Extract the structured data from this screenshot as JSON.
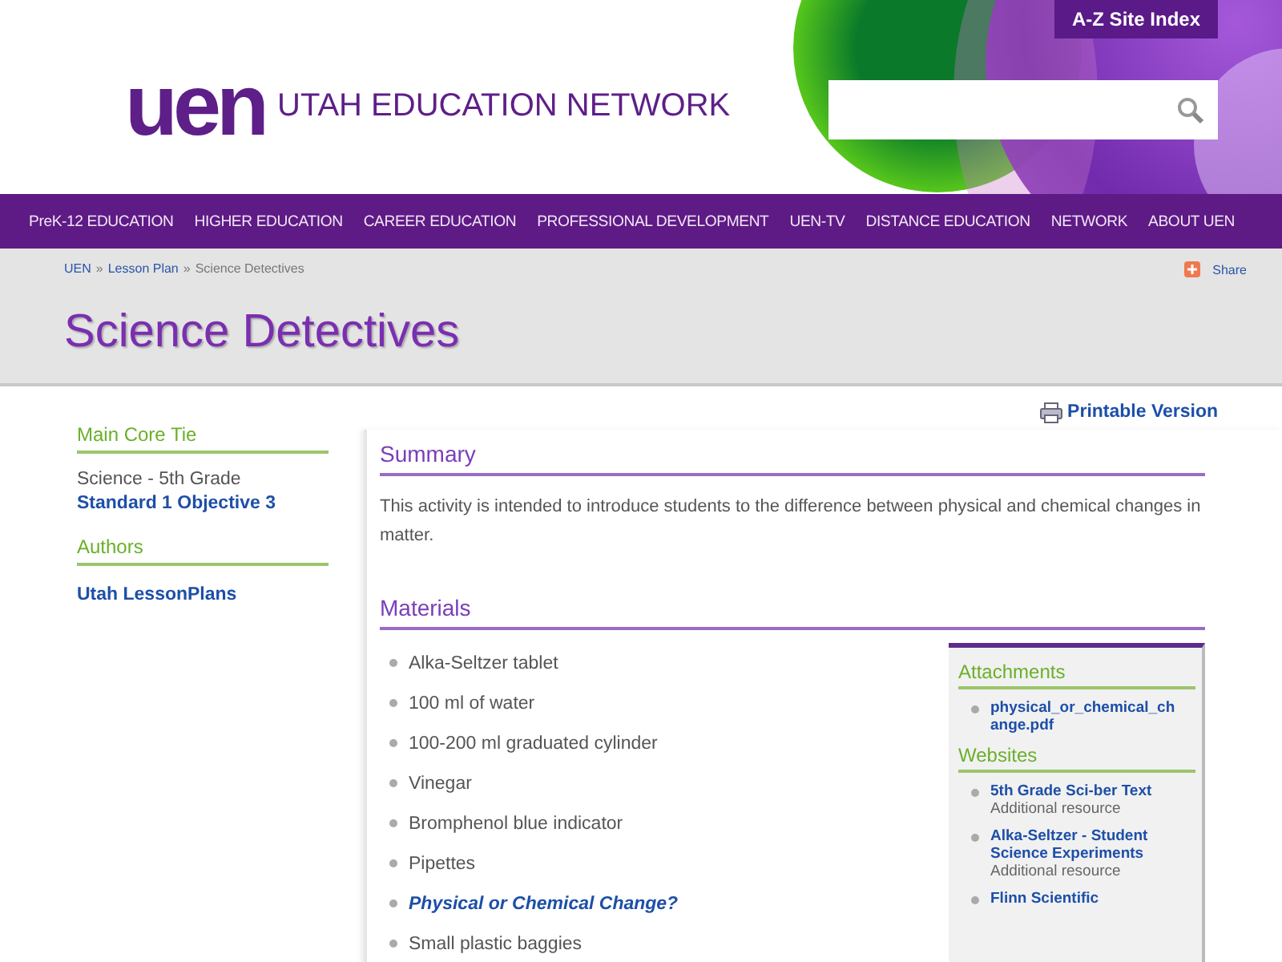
{
  "header": {
    "site_index": "A-Z Site Index",
    "logo": "uen",
    "site_name": "UTAH EDUCATION NETWORK"
  },
  "nav": [
    "PreK-12 EDUCATION",
    "HIGHER EDUCATION",
    "CAREER EDUCATION",
    "PROFESSIONAL DEVELOPMENT",
    "UEN-TV",
    "DISTANCE EDUCATION",
    "NETWORK",
    "ABOUT UEN"
  ],
  "breadcrumb": [
    "UEN",
    "Lesson Plan",
    "Science Detectives"
  ],
  "separator": "»",
  "share": "Share",
  "title": "Science Detectives",
  "printable": "Printable Version",
  "sidebar": {
    "core_heading": "Main Core Tie",
    "subject": "Science - 5th Grade",
    "standard": "Standard 1 Objective 3",
    "authors_heading": "Authors",
    "author": "Utah LessonPlans"
  },
  "summary": {
    "heading": "Summary",
    "text": "This activity is intended to introduce students to the difference between physical and chemical changes in matter."
  },
  "materials": {
    "heading": "Materials",
    "items": [
      {
        "kind": "text",
        "label": "Alka-Seltzer tablet"
      },
      {
        "kind": "text",
        "label": "100 ml of water"
      },
      {
        "kind": "text",
        "label": "100-200 ml graduated cylinder"
      },
      {
        "kind": "text",
        "label": "Vinegar"
      },
      {
        "kind": "text",
        "label": "Bromphenol blue indicator"
      },
      {
        "kind": "text",
        "label": "Pipettes"
      },
      {
        "kind": "link",
        "label": "Physical or Chemical Change?"
      },
      {
        "kind": "text",
        "label": "Small plastic baggies"
      }
    ]
  },
  "resources": {
    "attachments_heading": "Attachments",
    "attachments": [
      "physical_or_chemical_change.pdf"
    ],
    "websites_heading": "Websites",
    "websites": [
      {
        "title": "5th Grade Sci-ber Text",
        "note": "Additional resource"
      },
      {
        "title": "Alka-Seltzer - Student Science Experiments",
        "note": "Additional resource"
      },
      {
        "title": "Flinn Scientific"
      }
    ]
  }
}
